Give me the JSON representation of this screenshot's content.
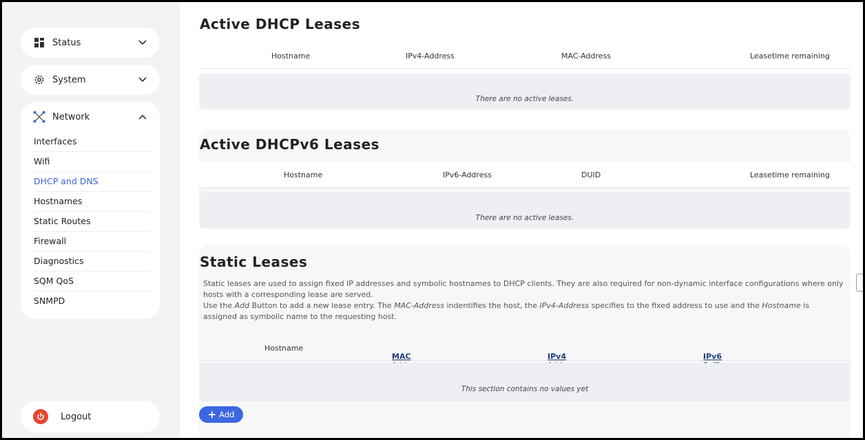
{
  "sidebar": {
    "status": {
      "label": "Status",
      "icon": "grid-icon"
    },
    "system": {
      "label": "System",
      "icon": "gear-icon"
    },
    "network": {
      "label": "Network",
      "icon": "network-icon",
      "items": [
        {
          "label": "Interfaces"
        },
        {
          "label": "Wifi"
        },
        {
          "label": "DHCP and DNS",
          "active": true
        },
        {
          "label": "Hostnames"
        },
        {
          "label": "Static Routes"
        },
        {
          "label": "Firewall"
        },
        {
          "label": "Diagnostics"
        },
        {
          "label": "SQM QoS"
        },
        {
          "label": "SNMPD"
        }
      ]
    },
    "logout": {
      "label": "Logout",
      "icon": "power-icon"
    }
  },
  "dhcp": {
    "title": "Active DHCP Leases",
    "columns": [
      "Hostname",
      "IPv4-Address",
      "MAC-Address",
      "Leasetime remaining"
    ],
    "empty": "There are no active leases."
  },
  "dhcpv6": {
    "title": "Active DHCPv6 Leases",
    "columns": [
      "Hostname",
      "IPv6-Address",
      "DUID",
      "Leasetime remaining"
    ],
    "empty": "There are no active leases."
  },
  "static": {
    "title": "Static Leases",
    "desc1": "Static leases are used to assign fixed IP addresses and symbolic hostnames to DHCP clients. They are also required for non-dynamic interface configurations where only hosts with a corresponding lease are served.",
    "desc2_a": "Use the ",
    "desc2_add": "Add",
    "desc2_b": " Button to add a new lease entry. The ",
    "desc2_mac": "MAC-Address",
    "desc2_c": " indentifies the host, the ",
    "desc2_ipv4": "IPv4-Address",
    "desc2_d": " specifies to the fixed address to use and the ",
    "desc2_host": "Hostname",
    "desc2_e": " is assigned as symbolic name to the requesting host.",
    "col_hostname": "Hostname",
    "col_mac_link": "MAC",
    "col_mac_rest": "-Address",
    "col_ipv4_link": "IPv4",
    "col_ipv4_rest": "-Address",
    "col_ipv6_link": "IPv6",
    "col_ipv6_rest": "-Suffix (hex)",
    "empty": "This section contains no values yet",
    "add_label": "Add"
  }
}
